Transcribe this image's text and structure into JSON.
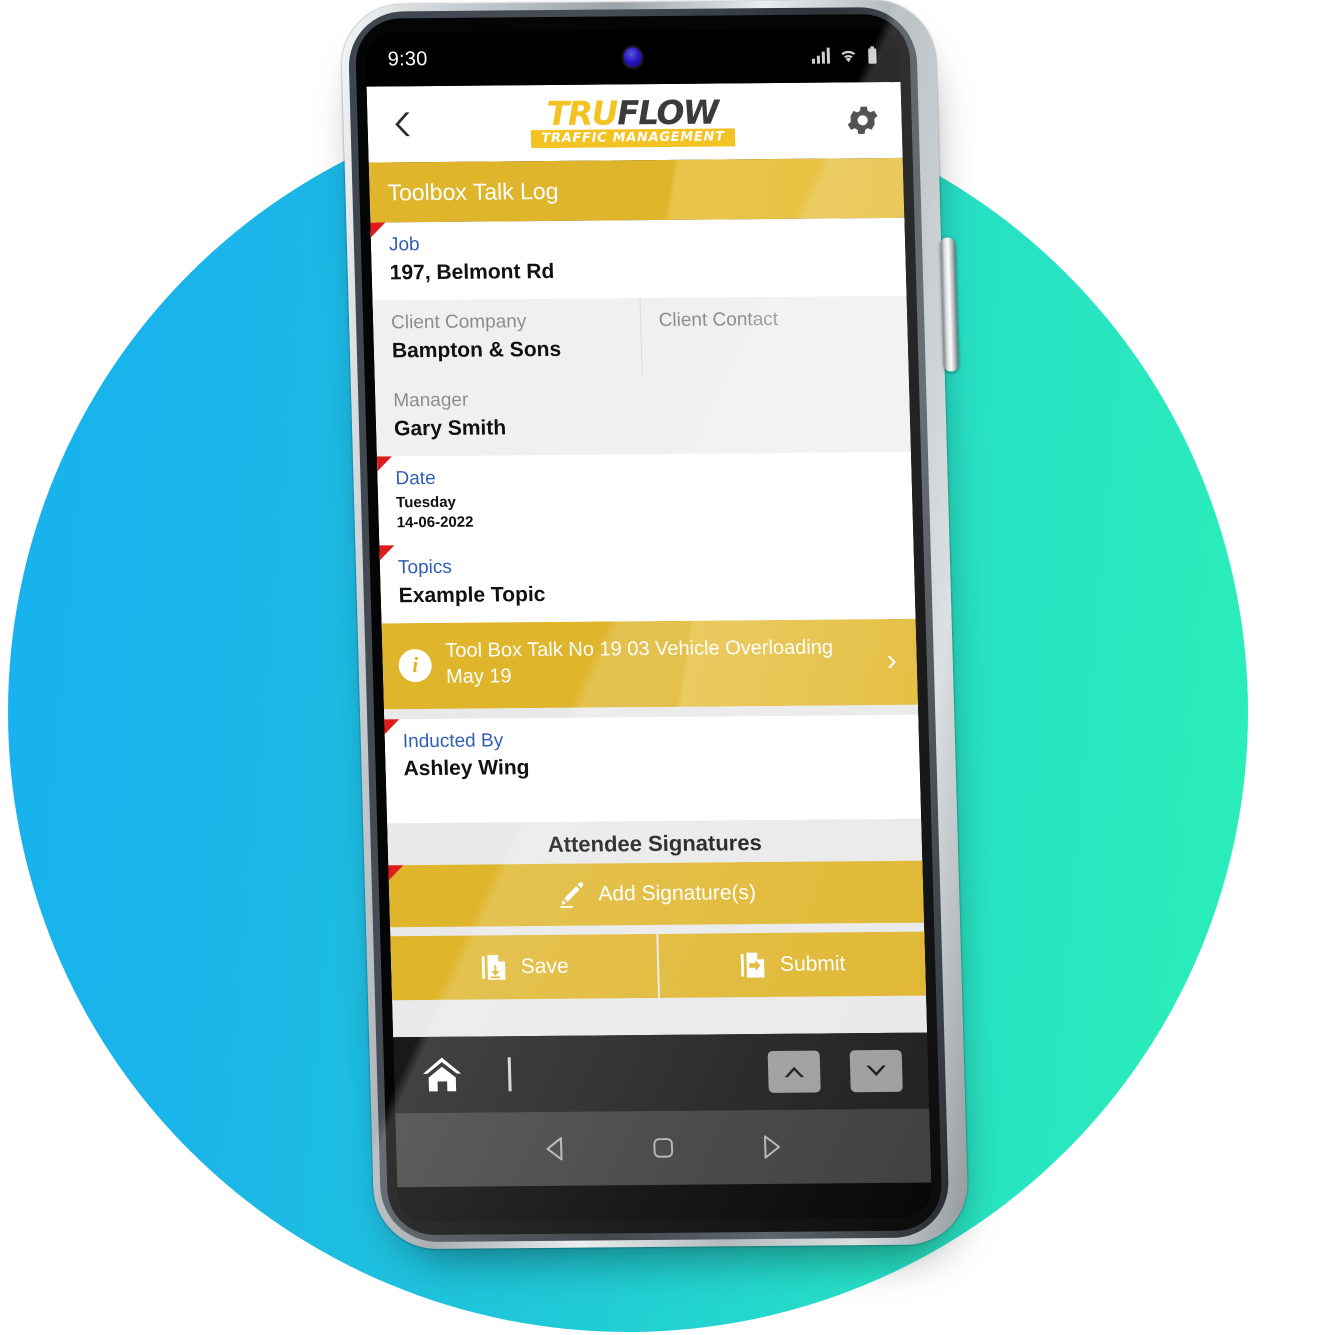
{
  "status_bar": {
    "time": "9:30",
    "icons": [
      "signal-icon",
      "wifi-icon",
      "battery-icon"
    ]
  },
  "app_header": {
    "back_icon": "back-chevron-icon",
    "logo_tru": "TRU",
    "logo_flow": "FLOW",
    "logo_tagline": "TRAFFIC MANAGEMENT",
    "settings_icon": "gear-icon"
  },
  "title_bar": {
    "title": "Toolbox Talk Log",
    "background_color": "#DFB52B"
  },
  "form": {
    "fields": [
      {
        "label": "Job",
        "value": "197, Belmont Rd"
      },
      {
        "label": "Client Company",
        "value": "Bampton & Sons"
      },
      {
        "label": "Client Contact",
        "value": ""
      },
      {
        "label": "Manager",
        "value": "Gary Smith"
      },
      {
        "label": "Date",
        "day": "Tuesday",
        "value": "14-06-2022"
      },
      {
        "label": "Topics",
        "value": "Example Topic"
      },
      {
        "label": "Inducted By",
        "value": "Ashley Wing"
      }
    ],
    "topic_banner": {
      "icon": "info-icon",
      "text": "Tool Box Talk No 19 03 Vehicle Overloading May 19",
      "chevron": "›"
    },
    "signatures": {
      "heading": "Attendee Signatures",
      "add_button_label": "Add Signature(s)",
      "add_button_icon": "pen-icon"
    },
    "actions": [
      {
        "label": "Save",
        "icon": "save-document-icon"
      },
      {
        "label": "Submit",
        "icon": "submit-document-icon"
      }
    ]
  },
  "app_toolbar": {
    "home_icon": "home-icon",
    "prev_icon": "chevron-up-icon",
    "next_icon": "chevron-down-icon"
  },
  "system_nav": {
    "back_icon": "android-back-icon",
    "home_icon": "android-home-icon",
    "recents_icon": "android-forward-icon"
  },
  "theme": {
    "accent_yellow": "#DFB52B",
    "label_blue": "#2F5FB5",
    "required_red": "#E01B1B",
    "background_gradient_start": "#17B2EF",
    "background_gradient_end": "#2BEFB8"
  }
}
